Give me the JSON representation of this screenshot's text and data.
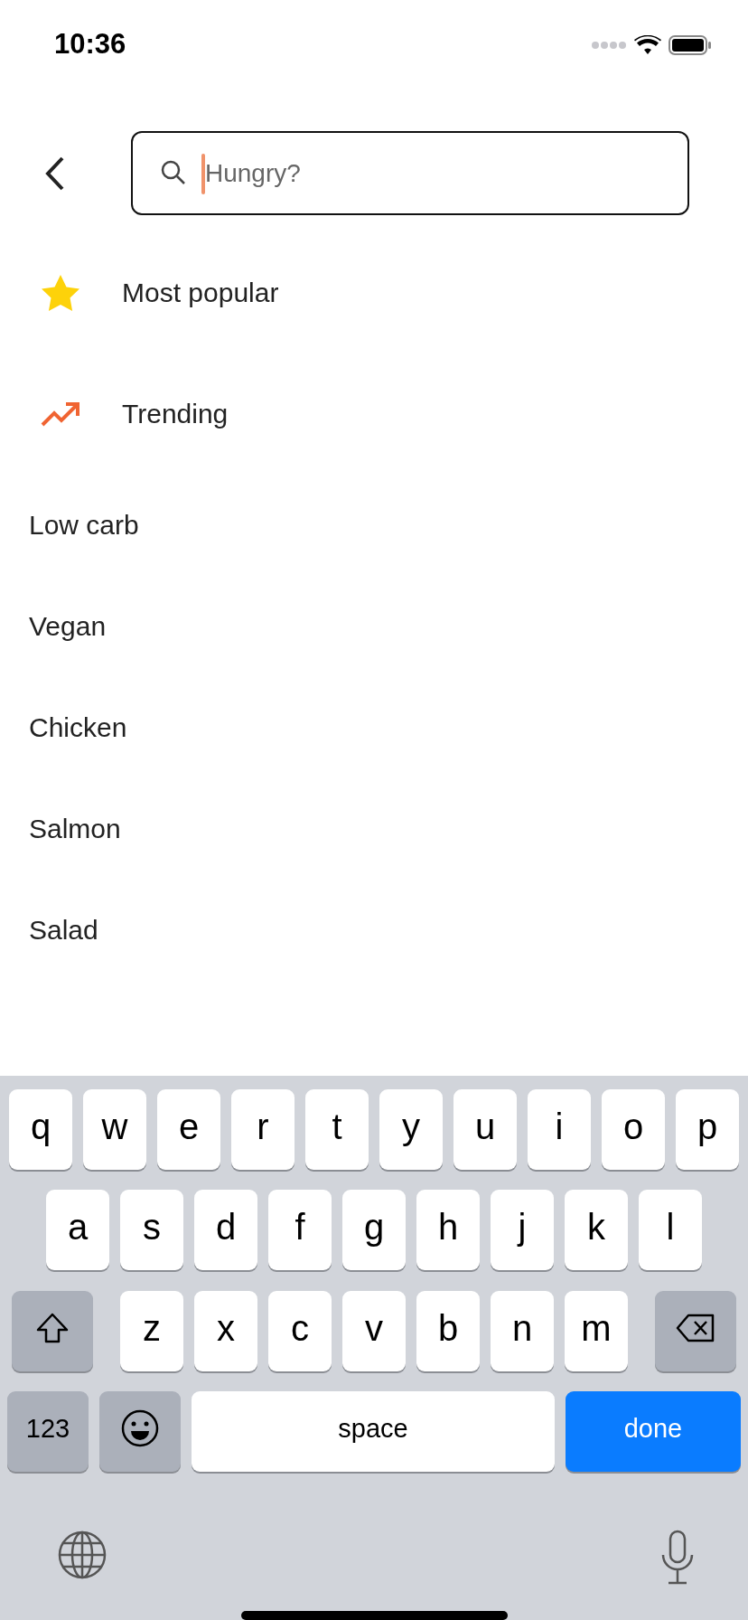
{
  "status_bar": {
    "time": "10:36"
  },
  "search": {
    "placeholder": "Hungry?",
    "focused": true
  },
  "suggestions": [
    {
      "kind": "star",
      "label": "Most popular"
    },
    {
      "kind": "trend",
      "label": "Trending"
    }
  ],
  "categories": [
    "Low carb",
    "Vegan",
    "Chicken",
    "Salmon",
    "Salad"
  ],
  "keyboard": {
    "letter_rows": [
      [
        "q",
        "w",
        "e",
        "r",
        "t",
        "y",
        "u",
        "i",
        "o",
        "p"
      ],
      [
        "a",
        "s",
        "d",
        "f",
        "g",
        "h",
        "j",
        "k",
        "l"
      ],
      [
        "z",
        "x",
        "c",
        "v",
        "b",
        "n",
        "m"
      ]
    ],
    "bottom_row": [
      {
        "kind": "numbers",
        "label": "123"
      },
      {
        "kind": "emoji"
      },
      {
        "kind": "space",
        "label": "space"
      },
      {
        "kind": "return",
        "label": "done"
      }
    ]
  }
}
